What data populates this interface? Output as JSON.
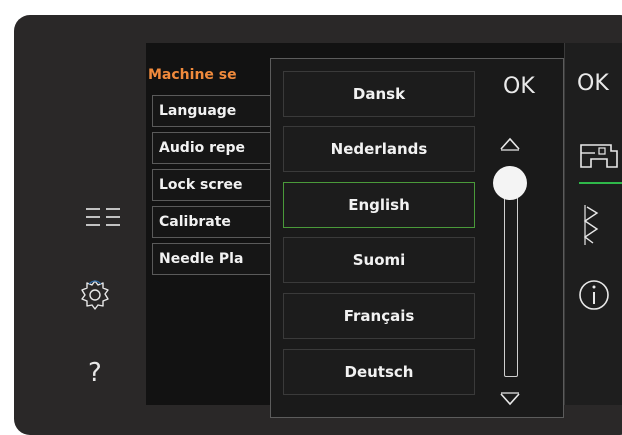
{
  "sidebar": {
    "icons": [
      "list-icon",
      "gear-icon",
      "help-icon"
    ],
    "help_label": "?"
  },
  "machine_settings": {
    "title": "Machine se",
    "rows": [
      "Language",
      "Audio repe",
      "Lock scree",
      "Calibrate",
      "Needle Pla"
    ]
  },
  "language_popup": {
    "ok_label": "OK",
    "languages": [
      "Dansk",
      "Nederlands",
      "English",
      "Suomi",
      "Français",
      "Deutsch"
    ],
    "selected": "English",
    "scroll_up_icon": "chevron-up-icon",
    "scroll_down_icon": "chevron-down-icon"
  },
  "right_panel": {
    "ok_label": "OK",
    "icons": [
      "sewing-machine-icon",
      "stitch-icon",
      "info-icon"
    ]
  },
  "colors": {
    "accent_orange": "#f08a3c",
    "selected_green": "#4a9a3a",
    "active_tab_green": "#2fb84a"
  }
}
